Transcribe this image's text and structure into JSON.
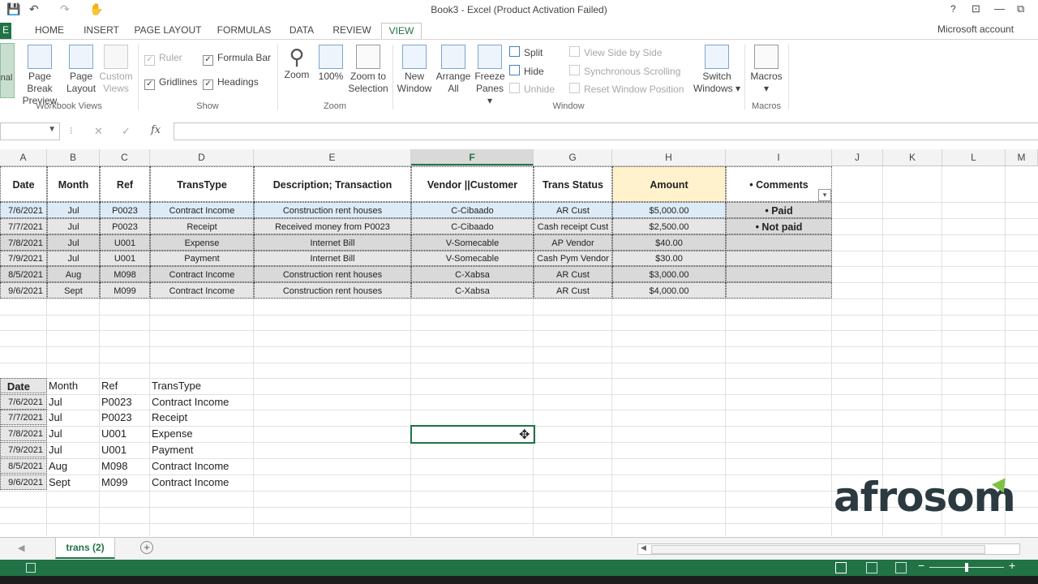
{
  "window": {
    "title": "Book3 - Excel (Product Activation Failed)",
    "account": "Microsoft account",
    "controls": [
      "?",
      "⊡",
      "—",
      "⧉"
    ]
  },
  "tabs": [
    {
      "label": "E"
    },
    {
      "label": "HOME"
    },
    {
      "label": "INSERT"
    },
    {
      "label": "PAGE LAYOUT"
    },
    {
      "label": "FORMULAS"
    },
    {
      "label": "DATA"
    },
    {
      "label": "REVIEW"
    },
    {
      "label": "VIEW"
    }
  ],
  "ribbon": {
    "workbook_views": {
      "group_label": "Workbook Views",
      "normal": "nal",
      "page_break_1": "Page Break",
      "page_break_2": "Preview",
      "page_layout_1": "Page",
      "page_layout_2": "Layout",
      "custom_views_1": "Custom",
      "custom_views_2": "Views"
    },
    "show": {
      "group_label": "Show",
      "ruler": "Ruler",
      "formula_bar": "Formula Bar",
      "gridlines": "Gridlines",
      "headings": "Headings"
    },
    "zoom": {
      "group_label": "Zoom",
      "zoom": "Zoom",
      "hundred": "100%",
      "zoom_sel_1": "Zoom to",
      "zoom_sel_2": "Selection"
    },
    "window": {
      "group_label": "Window",
      "new_window_1": "New",
      "new_window_2": "Window",
      "arrange_1": "Arrange",
      "arrange_2": "All",
      "freeze_1": "Freeze",
      "freeze_2": "Panes ▾",
      "split": "Split",
      "hide": "Hide",
      "unhide": "Unhide",
      "side_by_side": "View Side by Side",
      "sync_scroll": "Synchronous Scrolling",
      "reset_pos": "Reset Window Position",
      "switch_1": "Switch",
      "switch_2": "Windows ▾"
    },
    "macros": {
      "group_label": "Macros",
      "macros": "Macros",
      "arrow": "▾"
    }
  },
  "formula_bar": {
    "fx": "fx",
    "cancel": "✕",
    "enter": "✓",
    "colon": "⁝"
  },
  "columns": [
    {
      "letter": "A",
      "selected": false
    },
    {
      "letter": "B",
      "selected": false
    },
    {
      "letter": "C",
      "selected": false
    },
    {
      "letter": "D",
      "selected": false
    },
    {
      "letter": "E",
      "selected": false
    },
    {
      "letter": "F",
      "selected": true
    },
    {
      "letter": "G",
      "selected": false
    },
    {
      "letter": "H",
      "selected": false
    },
    {
      "letter": "I",
      "selected": false
    },
    {
      "letter": "J",
      "selected": false
    },
    {
      "letter": "K",
      "selected": false
    },
    {
      "letter": "L",
      "selected": false
    },
    {
      "letter": "M",
      "selected": false
    }
  ],
  "table1": {
    "headers": [
      "Date",
      "Month",
      "Ref",
      "TransType",
      "Description; Transaction",
      "Vendor ||Customer",
      "Trans Status",
      "Amount",
      "• Comments"
    ],
    "rows": [
      [
        "7/6/2021",
        "Jul",
        "P0023",
        "Contract Income",
        "Construction rent houses",
        "C-Cibaado",
        "AR Cust",
        "$5,000.00",
        "• Paid"
      ],
      [
        "7/7/2021",
        "Jul",
        "P0023",
        "Receipt",
        "Received money from P0023",
        "C-Cibaado",
        "Cash receipt Cust",
        "$2,500.00",
        "• Not paid"
      ],
      [
        "7/8/2021",
        "Jul",
        "U001",
        "Expense",
        "Internet Bill",
        "V-Somecable",
        "AP Vendor",
        "$40.00",
        ""
      ],
      [
        "7/9/2021",
        "Jul",
        "U001",
        "Payment",
        "Internet Bill",
        "V-Somecable",
        "Cash Pym Vendor",
        "$30.00",
        ""
      ],
      [
        "8/5/2021",
        "Aug",
        "M098",
        "Contract Income",
        "Construction rent houses",
        "C-Xabsa",
        "AR Cust",
        "$3,000.00",
        ""
      ],
      [
        "9/6/2021",
        "Sept",
        "M099",
        "Contract Income",
        "Construction rent houses",
        "C-Xabsa",
        "AR Cust",
        "$4,000.00",
        ""
      ]
    ],
    "row_colors": [
      "#ddebf7",
      "#e7e6e6",
      "#d9d9d9",
      "#e7e6e6",
      "#d9d9d9",
      "#e7e6e6"
    ],
    "amount_header_color": "#fff2cc",
    "filter_arrow": "▾"
  },
  "table2": {
    "headers": [
      "Date",
      "Month",
      "Ref",
      "TransType"
    ],
    "rows": [
      [
        "7/6/2021",
        "Jul",
        "P0023",
        "Contract Income"
      ],
      [
        "7/7/2021",
        "Jul",
        "P0023",
        "Receipt"
      ],
      [
        "7/8/2021",
        "Jul",
        "U001",
        "Expense"
      ],
      [
        "7/9/2021",
        "Jul",
        "U001",
        "Payment"
      ],
      [
        "8/5/2021",
        "Aug",
        "M098",
        "Contract Income"
      ],
      [
        "9/6/2021",
        "Sept",
        "M099",
        "Contract Income"
      ]
    ]
  },
  "logo": {
    "text": "afrosom",
    "accent": "#7dc242"
  },
  "sheet_tabs": [
    {
      "label": "trans (2)",
      "active": true
    }
  ],
  "colors": {
    "excel_green": "#217346"
  }
}
